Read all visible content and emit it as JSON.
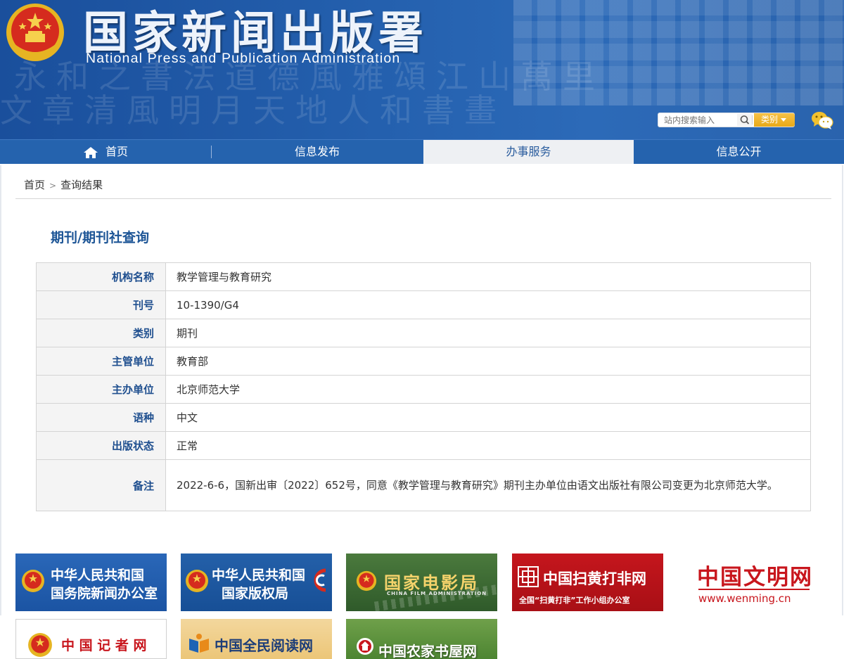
{
  "header": {
    "title": "国家新闻出版署",
    "subtitle": "National Press and Publication Administration",
    "search_placeholder": "站内搜索输入",
    "category_label": "类别"
  },
  "nav": {
    "items": [
      {
        "label": "首页"
      },
      {
        "label": "信息发布"
      },
      {
        "label": "办事服务"
      },
      {
        "label": "信息公开"
      }
    ]
  },
  "breadcrumb": {
    "home": "首页",
    "separator": ">",
    "current": "查询结果"
  },
  "main": {
    "title": "期刊/期刊社查询",
    "rows": [
      {
        "key": "机构名称",
        "value": "教学管理与教育研究"
      },
      {
        "key": "刊号",
        "value": "10-1390/G4"
      },
      {
        "key": "类别",
        "value": "期刊"
      },
      {
        "key": "主管单位",
        "value": "教育部"
      },
      {
        "key": "主办单位",
        "value": "北京师范大学"
      },
      {
        "key": "语种",
        "value": "中文"
      },
      {
        "key": "出版状态",
        "value": "正常"
      },
      {
        "key": "备注",
        "value": "2022-6-6，国新出审〔2022〕652号，同意《教学管理与教育研究》期刊主办单位由语文出版社有限公司变更为北京师范大学。"
      }
    ]
  },
  "links": {
    "scio": {
      "line1": "中华人民共和国",
      "line2": "国务院新闻办公室"
    },
    "ncac": {
      "line1": "中华人民共和国",
      "line2": "国家版权局"
    },
    "film": {
      "title": "国家电影局",
      "subtitle": "CHINA FILM ADMINISTRATION"
    },
    "shdf": {
      "title": "中国扫黄打非网",
      "subtitle": "全国“扫黄打非”工作小组办公室"
    },
    "wenming": {
      "title": "中国文明网",
      "url": "www.wenming.cn"
    },
    "journalist": {
      "title": "中 国 记 者 网"
    },
    "reading": {
      "title": "中国全民阅读网"
    },
    "farmhouse": {
      "title": "中国农家书屋网"
    }
  },
  "colors": {
    "brand_blue": "#2563ae",
    "label_blue": "#1f4f8f",
    "accent_gold": "#e9a918",
    "red": "#c8161d"
  }
}
